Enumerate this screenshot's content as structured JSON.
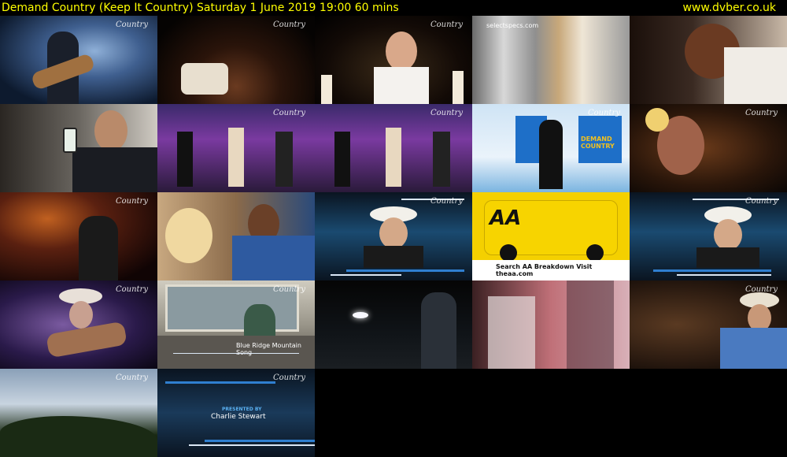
{
  "header": {
    "title": "Demand Country (Keep It Country)    Saturday 1 June 2019  19:00  60 mins",
    "site": "www.dvber.co.uk"
  },
  "thumbnails": [
    {
      "logo": "Country"
    },
    {
      "logo": "Country"
    },
    {
      "logo": "Country"
    },
    {
      "logo": "selectspecs.com"
    },
    {
      "logo": ""
    },
    {
      "logo": ""
    },
    {
      "logo": "Country"
    },
    {
      "logo": "Country"
    },
    {
      "logo": "Country",
      "caption": "DEMAND COUNTRY"
    },
    {
      "logo": "Country"
    },
    {
      "logo": "Country"
    },
    {
      "logo": "Country"
    },
    {
      "logo": "Country"
    },
    {
      "logo": "",
      "caption": "Search AA Breakdown  Visit theaa.com"
    },
    {
      "logo": "Country"
    },
    {
      "logo": "Country"
    },
    {
      "logo": "Country",
      "caption": "Blue Ridge Mountain Song"
    },
    {
      "logo": ""
    },
    {
      "logo": ""
    },
    {
      "logo": "Country"
    },
    {
      "logo": "Country"
    },
    {
      "logo": "Country",
      "caption": "PRESENTED BY",
      "caption2": "Charlie Stewart"
    }
  ]
}
